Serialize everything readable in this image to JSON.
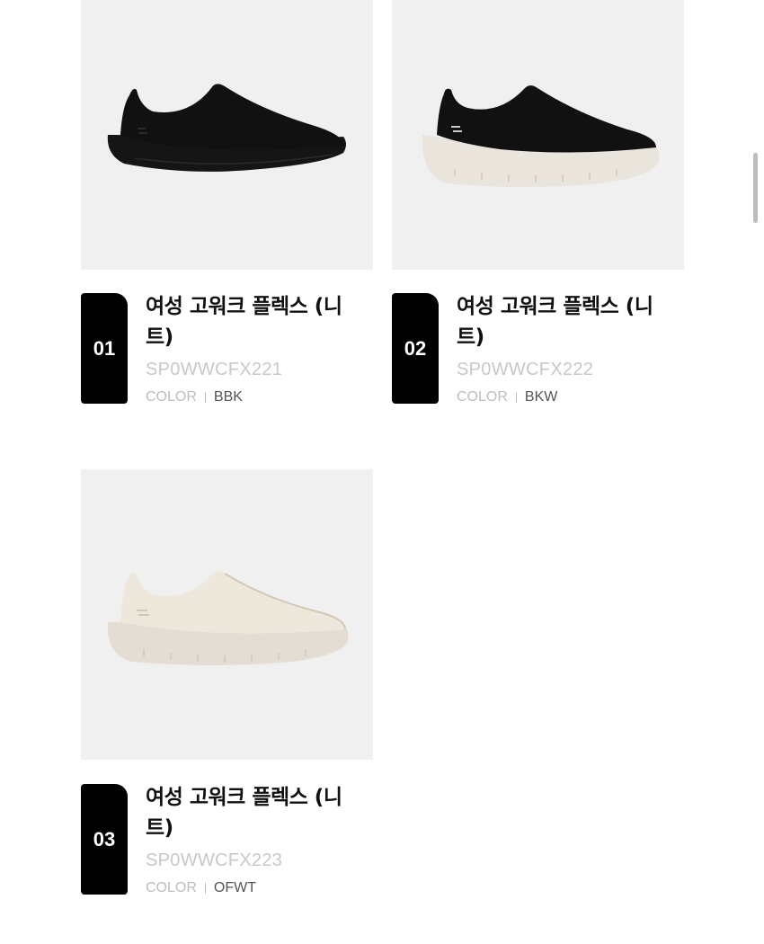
{
  "products": [
    {
      "index": "01",
      "name": "여성 고워크 플렉스 (니트)",
      "sku": "SP0WWCFX221",
      "color_label": "COLOR",
      "color_value": "BBK",
      "upper_color": "#111111",
      "sole_color": "#151515",
      "accent_color": "#2a2a2a"
    },
    {
      "index": "02",
      "name": "여성 고워크 플렉스 (니트)",
      "sku": "SP0WWCFX222",
      "color_label": "COLOR",
      "color_value": "BKW",
      "upper_color": "#111111",
      "sole_color": "#e9e4dc",
      "accent_color": "#cfc9c0"
    },
    {
      "index": "03",
      "name": "여성 고워크 플렉스 (니트)",
      "sku": "SP0WWCFX223",
      "color_label": "COLOR",
      "color_value": "OFWT",
      "upper_color": "#eee7dc",
      "sole_color": "#e4ddd3",
      "accent_color": "#d3c7b8"
    }
  ]
}
